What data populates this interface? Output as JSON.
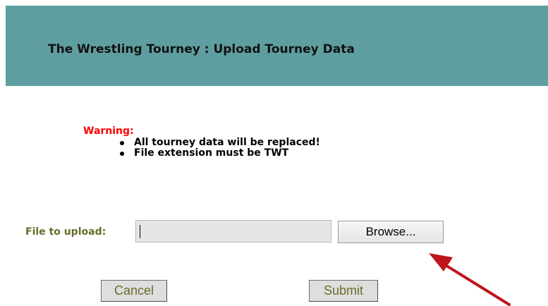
{
  "header": {
    "title": "The Wrestling Tourney : Upload Tourney Data",
    "background_color": "#5f9ea0"
  },
  "warning": {
    "label": "Warning:",
    "items": [
      "All tourney data will be replaced!",
      "File extension must be TWT"
    ],
    "label_color": "#ff0000"
  },
  "upload": {
    "label": "File to upload:",
    "input_value": "",
    "browse_label": "Browse..."
  },
  "actions": {
    "cancel_label": "Cancel",
    "submit_label": "Submit"
  },
  "annotation": {
    "icon": "arrow-icon",
    "color": "#c0141b"
  }
}
